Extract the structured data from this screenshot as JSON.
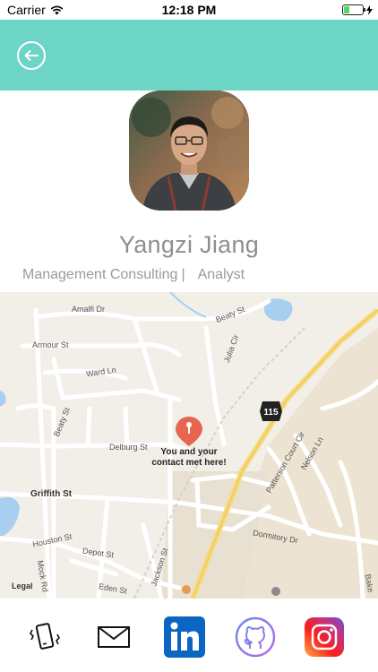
{
  "status_bar": {
    "carrier": "Carrier",
    "time": "12:18 PM"
  },
  "profile": {
    "name": "Yangzi Jiang",
    "company": "Management Consulting",
    "separator": "|",
    "title": "Analyst"
  },
  "map": {
    "pin_caption": "You and your contact met here!",
    "route_number": "115",
    "legal": "Legal",
    "streets": [
      "Amalfi Dr",
      "Beaty St",
      "Armour St",
      "Julia Cir",
      "Ward Ln",
      "Beaty St",
      "Delburg St",
      "Patterson Court Cir",
      "Nelson Ln",
      "Griffith St",
      "Houston St",
      "Depot St",
      "Dormitory Dr",
      "Jackson St",
      "Eden St",
      "Mock Rd",
      "Bake"
    ]
  },
  "actions": [
    {
      "icon": "phone-vibrate-icon"
    },
    {
      "icon": "mail-icon"
    },
    {
      "icon": "linkedin-icon",
      "color": "#0a66c2"
    },
    {
      "icon": "github-icon"
    },
    {
      "icon": "instagram-icon"
    }
  ],
  "colors": {
    "header": "#6dd5c6",
    "pin": "#e8654f",
    "map_bg": "#f2efe9"
  }
}
